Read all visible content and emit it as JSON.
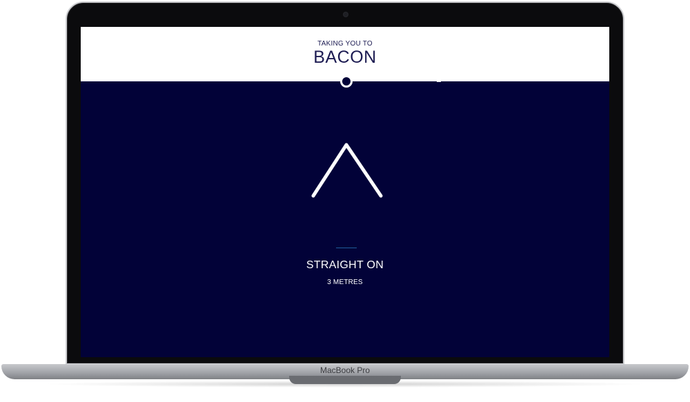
{
  "navigation": {
    "eyebrow": "TAKING YOU TO",
    "destination": "BACON",
    "instruction": "STRAIGHT ON",
    "distance": "3 METRES",
    "arrow_icon": "chevron-up-icon"
  },
  "device": {
    "brand_label": "MacBook Pro"
  },
  "colors": {
    "background": "#020238",
    "header_background": "#ffffff",
    "text_dark": "#1c1b52",
    "text_light": "#ffffff",
    "accent": "#1f5d9a"
  }
}
